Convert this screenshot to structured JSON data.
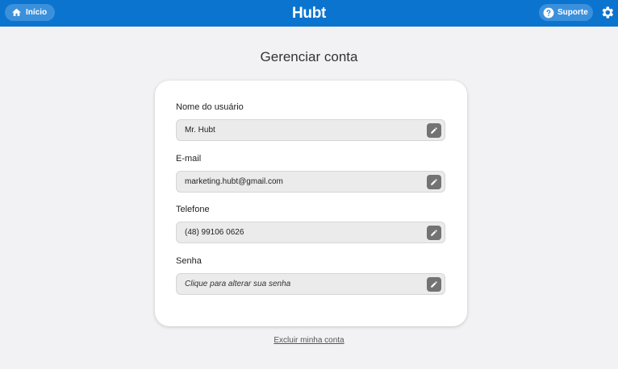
{
  "header": {
    "home_label": "Início",
    "logo": "Hubt",
    "support_label": "Suporte"
  },
  "page": {
    "title": "Gerenciar conta"
  },
  "fields": [
    {
      "label": "Nome do usuário",
      "value": "Mr. Hubt"
    },
    {
      "label": "E-mail",
      "value": "marketing.hubt@gmail.com"
    },
    {
      "label": "Telefone",
      "value": "(48) 99106 0626"
    },
    {
      "label": "Senha",
      "value": "Clique para alterar sua senha"
    }
  ],
  "footer": {
    "delete_label": "Excluir minha conta"
  },
  "colors": {
    "topbar": "#0b74cf",
    "pill": "#3b90dc",
    "edit_button": "#737373"
  },
  "icons": {
    "home": "home-icon",
    "support": "help-circle-icon",
    "settings": "gear-icon",
    "edit": "pencil-icon"
  }
}
